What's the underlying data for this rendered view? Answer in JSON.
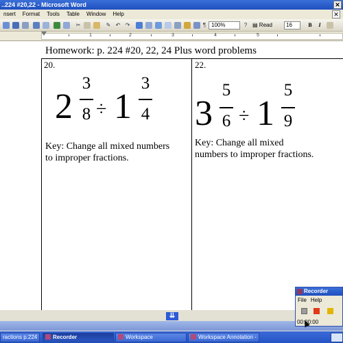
{
  "window": {
    "title": "..224 #20,22 - Microsoft Word"
  },
  "menu": {
    "items": [
      "nsert",
      "Format",
      "Tools",
      "Table",
      "Window",
      "Help"
    ]
  },
  "toolbar": {
    "zoom": "100%",
    "read_label": "Read",
    "font_size": "16",
    "bold": "B",
    "italic": "I"
  },
  "ruler": {
    "marks": [
      "1",
      "2",
      "3",
      "4",
      "5"
    ]
  },
  "document": {
    "heading": "Homework: p. 224 #20, 22, 24 Plus word problems",
    "problems": [
      {
        "number": "20.",
        "whole1": "2",
        "num1": "3",
        "den1": "8",
        "operator": "÷",
        "whole2": "1",
        "num2": "3",
        "den2": "4",
        "key": [
          "Key: Change all mixed numbers",
          "to improper fractions."
        ]
      },
      {
        "number": "22.",
        "whole1": "3",
        "num1": "5",
        "den1": "6",
        "operator": "÷",
        "whole2": "1",
        "num2": "5",
        "den2": "9",
        "key": [
          "Key: Change all mixed",
          "numbers to improper fractions."
        ]
      }
    ]
  },
  "taskbar": {
    "buttons": [
      "ractions p.224 ...",
      "Recorder",
      "Workspace",
      "Workspace Annotation - ..."
    ]
  },
  "recorder": {
    "title": "Recorder",
    "menu": [
      "File",
      "Help"
    ],
    "time": "00:00:00",
    "colors": {
      "stop": "#e03a1a",
      "pause": "#e3b400"
    }
  }
}
